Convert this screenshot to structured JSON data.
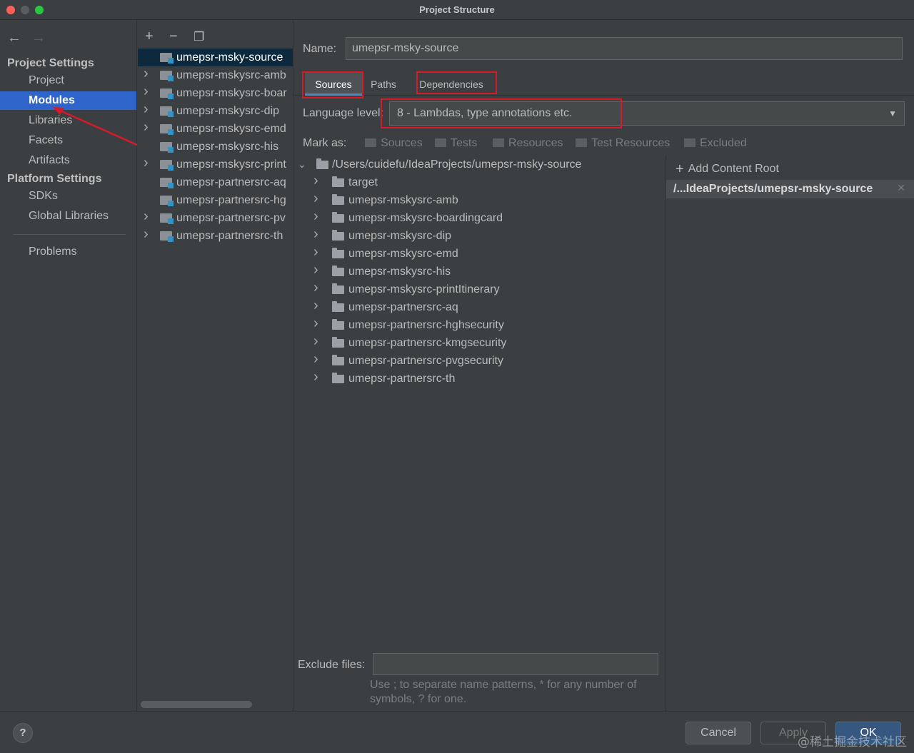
{
  "window": {
    "title": "Project Structure"
  },
  "nav": {
    "project_settings": "Project Settings",
    "items_top": [
      "Project",
      "Modules",
      "Libraries",
      "Facets",
      "Artifacts"
    ],
    "platform_settings": "Platform Settings",
    "items_platform": [
      "SDKs",
      "Global Libraries"
    ],
    "problems": "Problems",
    "selected": "Modules"
  },
  "modules": [
    {
      "label": "umepsr-msky-source",
      "expandable": false
    },
    {
      "label": "umepsr-mskysrc-amb",
      "expandable": true
    },
    {
      "label": "umepsr-mskysrc-boar",
      "expandable": true
    },
    {
      "label": "umepsr-mskysrc-dip",
      "expandable": true
    },
    {
      "label": "umepsr-mskysrc-emd",
      "expandable": true
    },
    {
      "label": "umepsr-mskysrc-his",
      "expandable": false
    },
    {
      "label": "umepsr-mskysrc-print",
      "expandable": true
    },
    {
      "label": "umepsr-partnersrc-aq",
      "expandable": false
    },
    {
      "label": "umepsr-partnersrc-hg",
      "expandable": false
    },
    {
      "label": "umepsr-partnersrc-pv",
      "expandable": true
    },
    {
      "label": "umepsr-partnersrc-th",
      "expandable": true
    }
  ],
  "main": {
    "name_label": "Name:",
    "name_value": "umepsr-msky-source",
    "tabs": [
      "Sources",
      "Paths",
      "Dependencies"
    ],
    "language_label": "Language level:",
    "language_value": "8 - Lambdas, type annotations etc.",
    "mark_as_label": "Mark as:",
    "mark_as": [
      "Sources",
      "Tests",
      "Resources",
      "Test Resources",
      "Excluded"
    ],
    "tree_root": "/Users/cuidefu/IdeaProjects/umepsr-msky-source",
    "tree_children": [
      "target",
      "umepsr-mskysrc-amb",
      "umepsr-mskysrc-boardingcard",
      "umepsr-mskysrc-dip",
      "umepsr-mskysrc-emd",
      "umepsr-mskysrc-his",
      "umepsr-mskysrc-printItinerary",
      "umepsr-partnersrc-aq",
      "umepsr-partnersrc-hghsecurity",
      "umepsr-partnersrc-kmgsecurity",
      "umepsr-partnersrc-pvgsecurity",
      "umepsr-partnersrc-th"
    ],
    "add_content_root": "Add Content Root",
    "content_root": "/...IdeaProjects/umepsr-msky-source",
    "exclude_label": "Exclude files:",
    "exclude_help": "Use ; to separate name patterns, * for any number of symbols, ? for one."
  },
  "buttons": {
    "help": "?",
    "cancel": "Cancel",
    "apply": "Apply",
    "ok": "OK"
  },
  "watermark": "@稀土掘金技术社区",
  "colors": {
    "selection": "#2f65ca",
    "annotation_red": "#d51a2a",
    "ok_button": "#365880"
  }
}
